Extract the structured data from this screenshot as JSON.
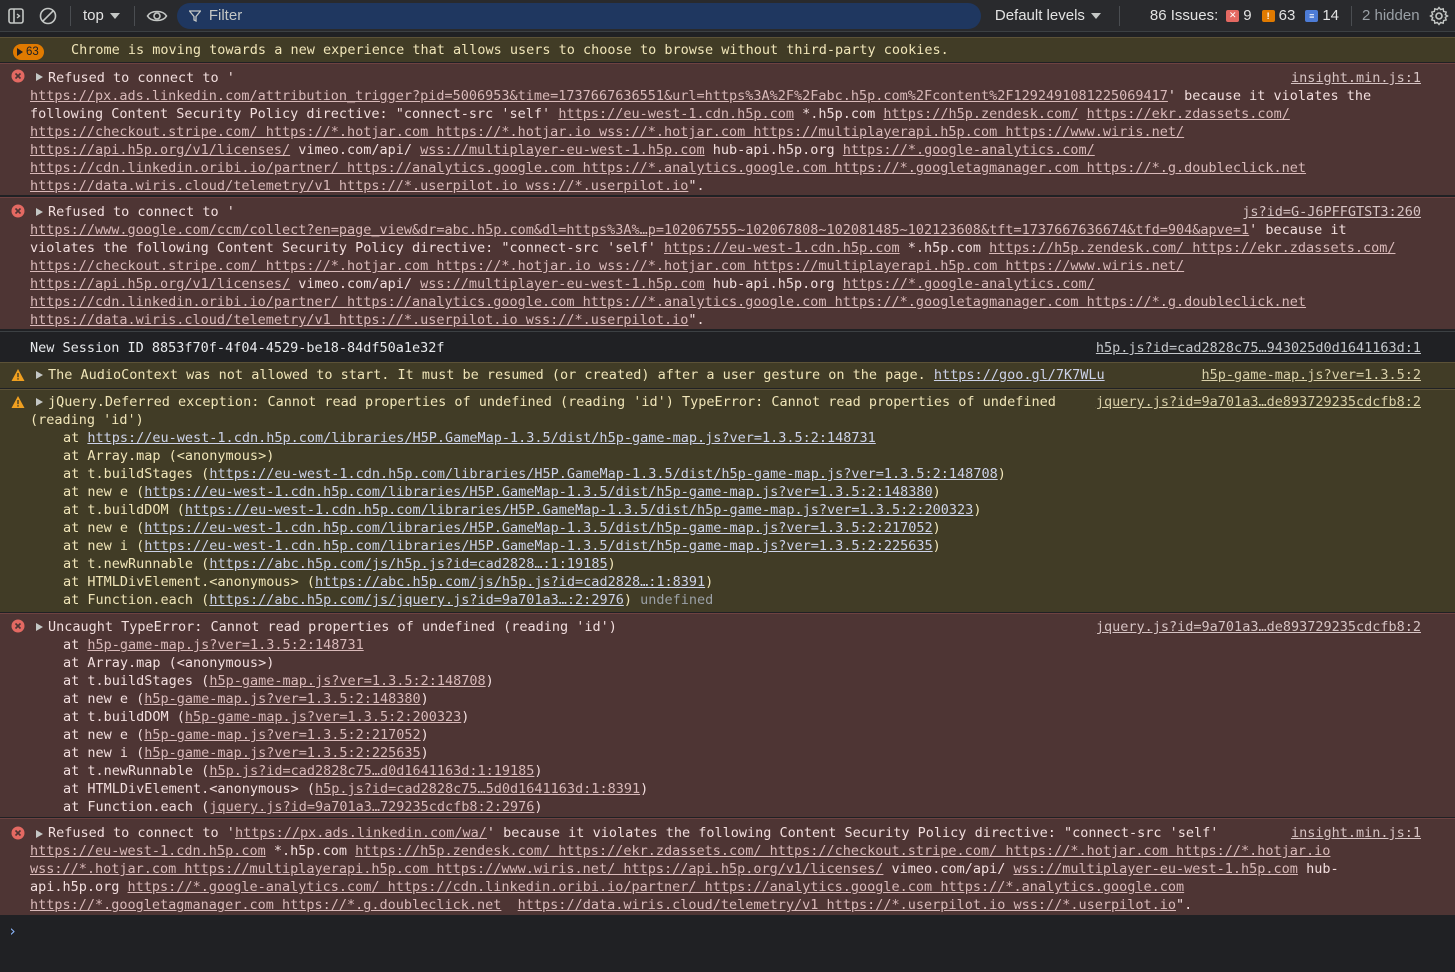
{
  "toolbar": {
    "context": "top",
    "filter_placeholder": "Filter",
    "levels": "Default levels",
    "issues_label": "86 Issues:",
    "issues_errors": "9",
    "issues_warnings": "63",
    "issues_info": "14",
    "hidden": "2 hidden"
  },
  "messages": {
    "m0": {
      "count": "63",
      "text": "Chrome is moving towards a new experience that allows users to choose to browse without third-party cookies."
    },
    "m1": {
      "source": "insight.min.js:1",
      "l0": "Refused to connect to '",
      "l1_link": "https://px.ads.linkedin.com/attribution_trigger?pid=5006953&time=1737667636551&url=https%3A%2F%2Fabc.h5p.com%2Fcontent%2F1292491081225069417",
      "l1_tail": "' because it violates the",
      "l2_a": "following Content Security Policy directive: \"connect-src 'self' ",
      "l2_b": "https://eu-west-1.cdn.h5p.com",
      "l2_c": " *.h5p.com ",
      "l2_d": "https://h5p.zendesk.com/",
      "l2_e": " ",
      "l2_f": "https://ekr.zdassets.com/",
      "l3": "https://checkout.stripe.com/ https://*.hotjar.com https://*.hotjar.io wss://*.hotjar.com https://multiplayerapi.h5p.com https://www.wiris.net/",
      "l4_a": "https://api.h5p.org/v1/licenses/",
      "l4_b": " vimeo.com/api/ ",
      "l4_c": "wss://multiplayer-eu-west-1.h5p.com",
      "l4_d": " hub-api.h5p.org ",
      "l4_e": "https://*.google-analytics.com/",
      "l5": "https://cdn.linkedin.oribi.io/partner/ https://analytics.google.com https://*.analytics.google.com https://*.googletagmanager.com https://*.g.doubleclick.net",
      "l6_a": "https://data.wiris.cloud/telemetry/v1 https://*.userpilot.io wss://*.userpilot.io",
      "l6_b": "\"."
    },
    "m2": {
      "source": "js?id=G-J6PFFGTST3:260",
      "l0": "Refused to connect to '",
      "l1_link": "https://www.google.com/ccm/collect?en=page_view&dr=abc.h5p.com&dl=https%3A%…p=102067555~102067808~102081485~102123608&tft=1737667636674&tfd=904&apve=1",
      "l1_tail": "' because it",
      "l2_a": "violates the following Content Security Policy directive: \"connect-src 'self' ",
      "l2_b": "https://eu-west-1.cdn.h5p.com",
      "l2_c": " *.h5p.com ",
      "l2_d": "https://h5p.zendesk.com/ https://ekr.zdassets.com/",
      "l3": "https://checkout.stripe.com/ https://*.hotjar.com https://*.hotjar.io wss://*.hotjar.com https://multiplayerapi.h5p.com https://www.wiris.net/",
      "l4_a": "https://api.h5p.org/v1/licenses/",
      "l4_b": " vimeo.com/api/ ",
      "l4_c": "wss://multiplayer-eu-west-1.h5p.com",
      "l4_d": " hub-api.h5p.org ",
      "l4_e": "https://*.google-analytics.com/",
      "l5": "https://cdn.linkedin.oribi.io/partner/ https://analytics.google.com https://*.analytics.google.com https://*.googletagmanager.com https://*.g.doubleclick.net",
      "l6_a": "https://data.wiris.cloud/telemetry/v1 https://*.userpilot.io wss://*.userpilot.io",
      "l6_b": "\"."
    },
    "m3": {
      "text": "New Session ID 8853f70f-4f04-4529-be18-84df50a1e32f",
      "source": "h5p.js?id=cad2828c75…943025d0d1641163d:1"
    },
    "m4": {
      "text": "The AudioContext was not allowed to start. It must be resumed (or created) after a user gesture on the page. ",
      "link": "https://goo.gl/7K7WLu",
      "source": "h5p-game-map.js?ver=1.3.5:2"
    },
    "m5": {
      "source": "jquery.js?id=9a701a3…de893729235cdcfb8:2",
      "l0": "jQuery.Deferred exception: Cannot read properties of undefined (reading 'id') TypeError: Cannot read properties of undefined",
      "l1": "(reading 'id')",
      "s0_a": "at ",
      "s0_b": "https://eu-west-1.cdn.h5p.com/libraries/H5P.GameMap-1.3.5/dist/h5p-game-map.js?ver=1.3.5:2:148731",
      "s1": "at Array.map (<anonymous>)",
      "s2_a": "at t.buildStages (",
      "s2_b": "https://eu-west-1.cdn.h5p.com/libraries/H5P.GameMap-1.3.5/dist/h5p-game-map.js?ver=1.3.5:2:148708",
      "s2_c": ")",
      "s3_a": "at new e (",
      "s3_b": "https://eu-west-1.cdn.h5p.com/libraries/H5P.GameMap-1.3.5/dist/h5p-game-map.js?ver=1.3.5:2:148380",
      "s3_c": ")",
      "s4_a": "at t.buildDOM (",
      "s4_b": "https://eu-west-1.cdn.h5p.com/libraries/H5P.GameMap-1.3.5/dist/h5p-game-map.js?ver=1.3.5:2:200323",
      "s4_c": ")",
      "s5_a": "at new e (",
      "s5_b": "https://eu-west-1.cdn.h5p.com/libraries/H5P.GameMap-1.3.5/dist/h5p-game-map.js?ver=1.3.5:2:217052",
      "s5_c": ")",
      "s6_a": "at new i (",
      "s6_b": "https://eu-west-1.cdn.h5p.com/libraries/H5P.GameMap-1.3.5/dist/h5p-game-map.js?ver=1.3.5:2:225635",
      "s6_c": ")",
      "s7_a": "at t.newRunnable (",
      "s7_b": "https://abc.h5p.com/js/h5p.js?id=cad2828…:1:19185",
      "s7_c": ")",
      "s8_a": "at HTMLDivElement.<anonymous> (",
      "s8_b": "https://abc.h5p.com/js/h5p.js?id=cad2828…:1:8391",
      "s8_c": ")",
      "s9_a": "at Function.each (",
      "s9_b": "https://abc.h5p.com/js/jquery.js?id=9a701a3…:2:2976",
      "s9_c": ") ",
      "s9_d": "undefined"
    },
    "m6": {
      "source": "jquery.js?id=9a701a3…de893729235cdcfb8:2",
      "l0": "Uncaught TypeError: Cannot read properties of undefined (reading 'id')",
      "s0_a": "at ",
      "s0_b": "h5p-game-map.js?ver=1.3.5:2:148731",
      "s1": "at Array.map (<anonymous>)",
      "s2_a": "at t.buildStages (",
      "s2_b": "h5p-game-map.js?ver=1.3.5:2:148708",
      "s2_c": ")",
      "s3_a": "at new e (",
      "s3_b": "h5p-game-map.js?ver=1.3.5:2:148380",
      "s3_c": ")",
      "s4_a": "at t.buildDOM (",
      "s4_b": "h5p-game-map.js?ver=1.3.5:2:200323",
      "s4_c": ")",
      "s5_a": "at new e (",
      "s5_b": "h5p-game-map.js?ver=1.3.5:2:217052",
      "s5_c": ")",
      "s6_a": "at new i (",
      "s6_b": "h5p-game-map.js?ver=1.3.5:2:225635",
      "s6_c": ")",
      "s7_a": "at t.newRunnable (",
      "s7_b": "h5p.js?id=cad2828c75…d0d1641163d:1:19185",
      "s7_c": ")",
      "s8_a": "at HTMLDivElement.<anonymous> (",
      "s8_b": "h5p.js?id=cad2828c75…5d0d1641163d:1:8391",
      "s8_c": ")",
      "s9_a": "at Function.each (",
      "s9_b": "jquery.js?id=9a701a3…729235cdcfb8:2:2976",
      "s9_c": ")"
    },
    "m7": {
      "source": "insight.min.js:1",
      "l0_a": "Refused to connect to '",
      "l0_b": "https://px.ads.linkedin.com/wa/",
      "l0_c": "' because it violates the following Content Security Policy directive: \"connect-src 'self'",
      "l1_a": "https://eu-west-1.cdn.h5p.com",
      "l1_b": " *.h5p.com ",
      "l1_c": "https://h5p.zendesk.com/ https://ekr.zdassets.com/ https://checkout.stripe.com/ https://*.hotjar.com https://*.hotjar.io",
      "l2_a": "wss://*.hotjar.com https://multiplayerapi.h5p.com https://www.wiris.net/ https://api.h5p.org/v1/licenses/",
      "l2_b": " vimeo.com/api/ ",
      "l2_c": "wss://multiplayer-eu-west-1.h5p.com",
      "l2_d": " hub-",
      "l3_a": "api.h5p.org ",
      "l3_b": "https://*.google-analytics.com/ https://cdn.linkedin.oribi.io/partner/ https://analytics.google.com https://*.analytics.google.com",
      "l4_a": "https://*.googletagmanager.com https://*.g.doubleclick.net",
      "l4_b": "  ",
      "l4_c": "https://data.wiris.cloud/telemetry/v1 https://*.userpilot.io wss://*.userpilot.io",
      "l4_d": "\"."
    }
  },
  "colors": {
    "warning": "#f0a020",
    "error": "#e46962",
    "info": "#8ab4f8"
  }
}
